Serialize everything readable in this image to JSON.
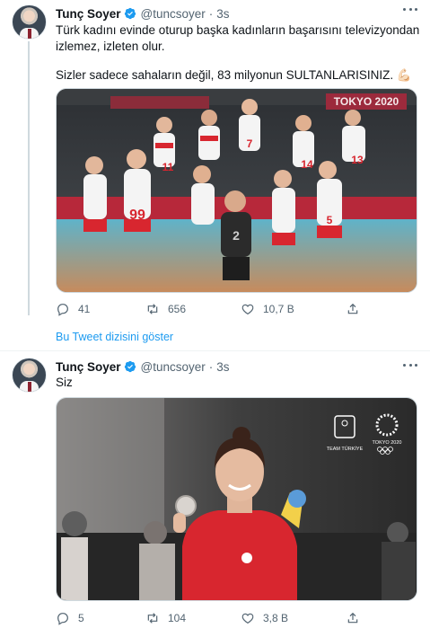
{
  "tweet1": {
    "author_name": "Tunç Soyer",
    "handle": "@tuncsoyer",
    "separator": "·",
    "time": "3s",
    "text_line1": "Türk kadını evinde oturup başka kadınların başarısını televizyondan",
    "text_line2": "izlemez, izleten olur.",
    "text_line3": "Sizler sadece sahaların değil, 83 milyonun SULTANLARISINIZ. 💪🏻",
    "photo_banner": "TOKYO 2020",
    "jersey_numbers": [
      "11",
      "99",
      "7",
      "14",
      "13",
      "5",
      "2"
    ],
    "replies": "41",
    "retweets": "656",
    "likes": "10,7 B"
  },
  "show_thread_label": "Bu Tweet dizisini göster",
  "tweet2": {
    "author_name": "Tunç Soyer",
    "handle": "@tuncsoyer",
    "separator": "·",
    "time": "3s",
    "text": "Siz",
    "logo_left_caption": "TEAM TÜRKİYE",
    "logo_right_caption": "TOKYO 2020",
    "replies": "5",
    "retweets": "104",
    "likes": "3,8 B"
  },
  "icons": [
    "verified-badge-icon",
    "more-icon",
    "reply-icon",
    "retweet-icon",
    "like-icon",
    "share-icon"
  ],
  "colors": {
    "accent": "#1d9bf0",
    "secondary_text": "#536471",
    "jersey_red": "#d8262f"
  }
}
